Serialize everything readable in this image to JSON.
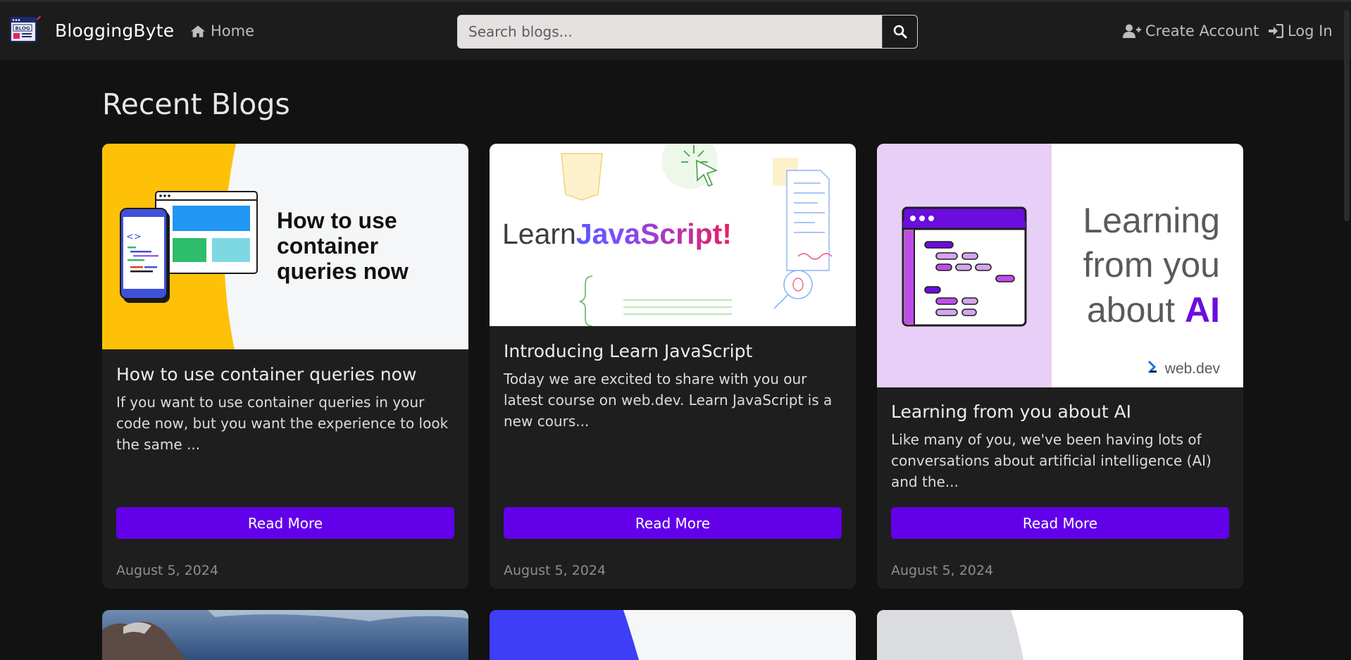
{
  "brand": {
    "name": "BloggingByte",
    "logo_text": "BLOG"
  },
  "nav": {
    "home": "Home",
    "create_account": "Create Account",
    "log_in": "Log In"
  },
  "search": {
    "placeholder": "Search blogs..."
  },
  "section_title": "Recent Blogs",
  "cards": [
    {
      "image_text": [
        "How to use",
        "container",
        "queries now"
      ],
      "title": "How to use container queries now",
      "excerpt": "If you want to use container queries in your code now, but you want the experience to look the same ...",
      "button": "Read More",
      "date": "August 5, 2024"
    },
    {
      "image_text": [
        "Learn",
        "JavaScript!"
      ],
      "title": "Introducing Learn JavaScript",
      "excerpt": "Today we are excited to share with you our latest course on web.dev. Learn JavaScript is a new cours...",
      "button": "Read More",
      "date": "August 5, 2024"
    },
    {
      "image_text": [
        "Learning",
        "from you",
        "about ",
        "AI",
        "web.dev"
      ],
      "title": "Learning from you about AI",
      "excerpt": "Like many of you, we've been having lots of conversations about artificial intelligence (AI) and the...",
      "button": "Read More",
      "date": "August 5, 2024"
    }
  ],
  "colors": {
    "accent": "#6200ea",
    "background": "#121212",
    "navbar": "#1c1c1c",
    "card": "#1e1e1e"
  }
}
